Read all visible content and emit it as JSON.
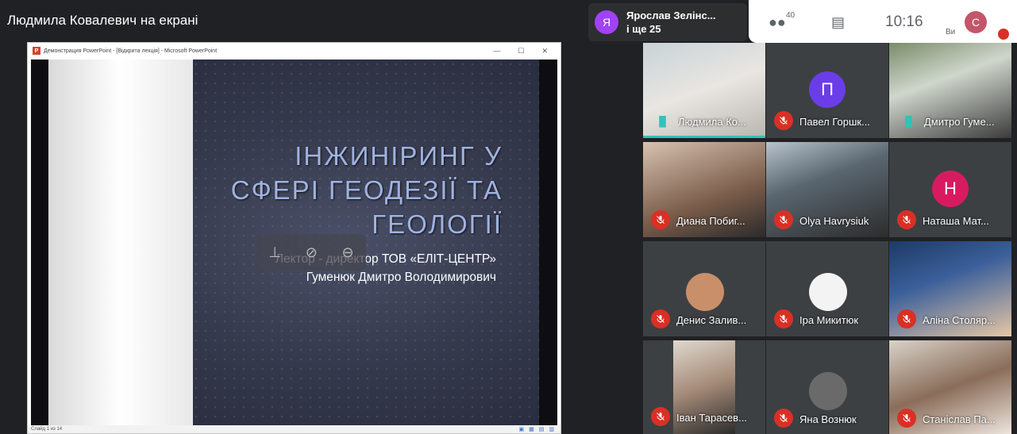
{
  "presenter": {
    "title": "Людмила Ковалевич на екрані"
  },
  "ppt": {
    "window_title": "Демонстрация PowerPoint - [Відкрита лекція] - Microsoft PowerPoint",
    "status_left": "Слайд 1 из 14",
    "slide": {
      "heading_lines": [
        "ІНЖИНІРИНГ У",
        "СФЕРІ ГЕОДЕЗІЇ ТА",
        "ГЕОЛОГІЇ"
      ],
      "sub_lines": [
        "Лектор - директор ТОВ «ЕЛІТ-ЦЕНТР»",
        "Гуменюк Дмитро Володимирович"
      ]
    },
    "overlay_icons": [
      "pin-icon",
      "mute-icon",
      "remove-icon"
    ]
  },
  "banner": {
    "avatar_letter": "Я",
    "line1": "Ярослав Зелінс...",
    "line2": "і ще 25"
  },
  "topbar": {
    "people_count": "40",
    "time": "10:16",
    "you_label": "Ви",
    "avatar_letter": "С"
  },
  "tiles": [
    {
      "name": "Людмила Ко...",
      "type": "photo",
      "muted": false,
      "active": true
    },
    {
      "name": "Павел Горшк...",
      "type": "letter",
      "letter": "П",
      "color": "#6a3de8",
      "muted": true
    },
    {
      "name": "Дмитро Гуме...",
      "type": "photo",
      "muted": false
    },
    {
      "name": "Диана Побиг...",
      "type": "photo",
      "muted": true
    },
    {
      "name": "Olya Havrysiuk",
      "type": "photo",
      "muted": true
    },
    {
      "name": "Наташа Мат...",
      "type": "letter",
      "letter": "Н",
      "color": "#d81b60",
      "muted": true
    },
    {
      "name": "Денис Залив...",
      "type": "avatar",
      "muted": true
    },
    {
      "name": "Іра Микитюк",
      "type": "avatar",
      "muted": true
    },
    {
      "name": "Аліна Столяр...",
      "type": "photo",
      "muted": true
    },
    {
      "name": "Іван Тарасев...",
      "type": "photo",
      "muted": true
    },
    {
      "name": "Яна Вознюк",
      "type": "avatar",
      "muted": true
    },
    {
      "name": "Станіслав Па...",
      "type": "photo",
      "muted": true
    }
  ]
}
